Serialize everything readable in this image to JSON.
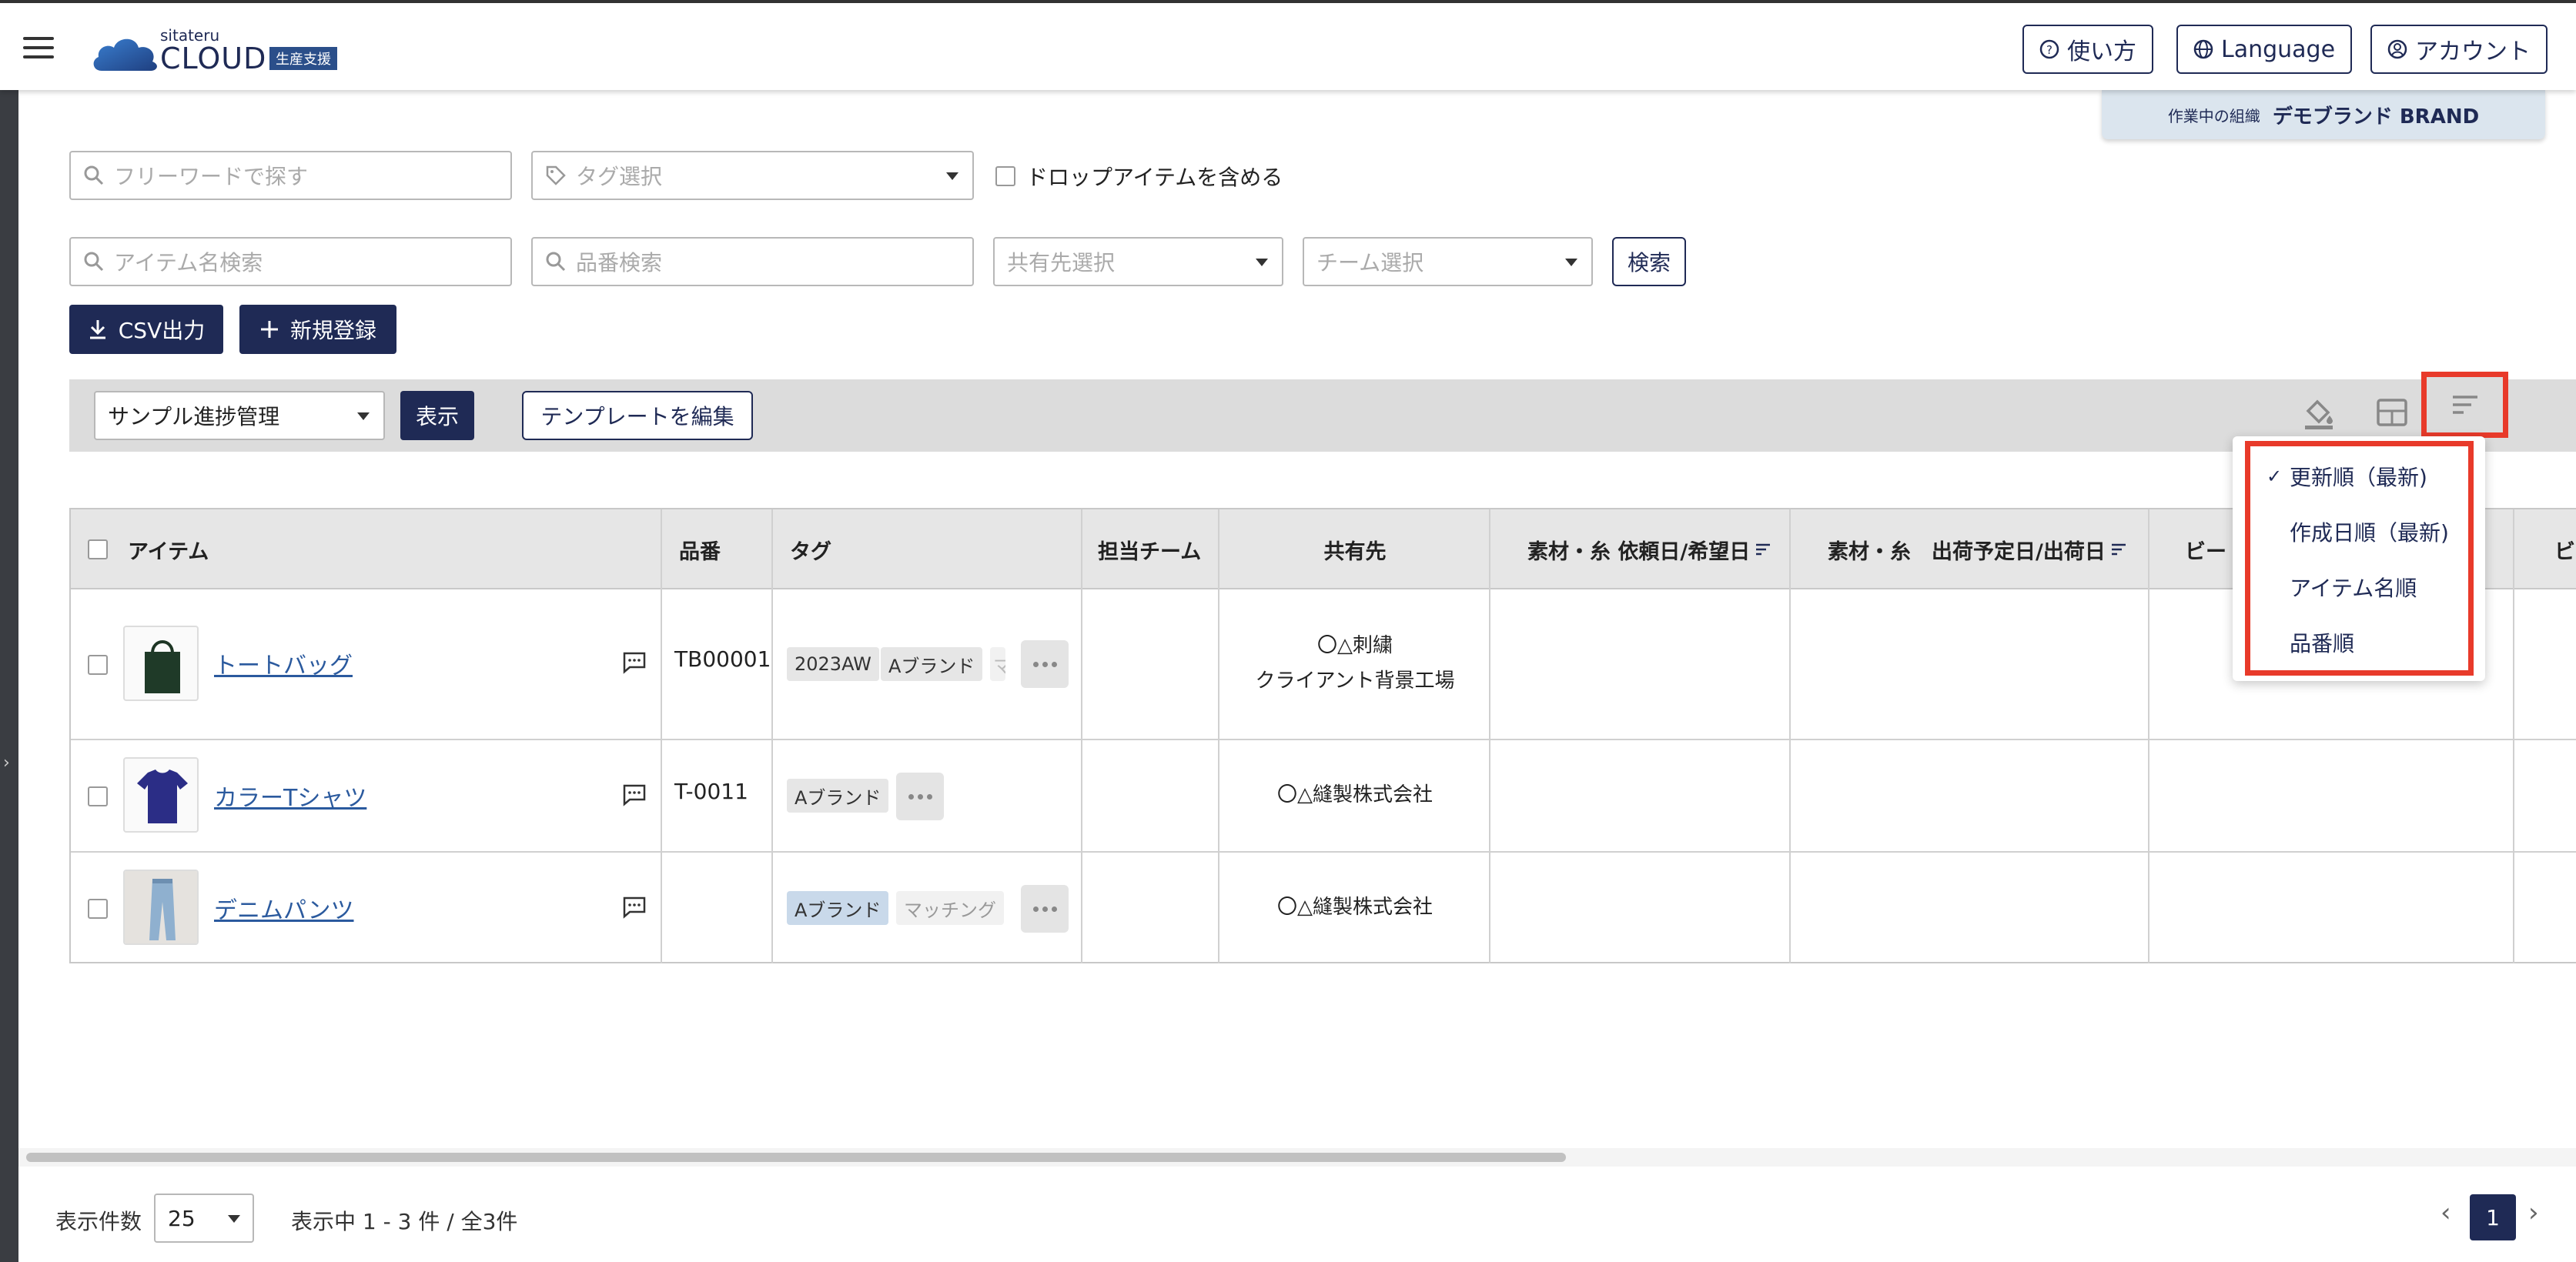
{
  "header": {
    "logo_small": "sitateru",
    "logo_main": "CLOUD",
    "logo_badge": "生産支援",
    "help_label": "使い方",
    "language_label": "Language",
    "account_label": "アカウント",
    "org_label": "作業中の組織",
    "org_name": "デモブランド BRAND"
  },
  "filters": {
    "freeword_placeholder": "フリーワードで探す",
    "tag_placeholder": "タグ選択",
    "include_drop_label": "ドロップアイテムを含める",
    "item_name_placeholder": "アイテム名検索",
    "part_number_placeholder": "品番検索",
    "share_placeholder": "共有先選択",
    "team_placeholder": "チーム選択",
    "search_label": "検索"
  },
  "actions": {
    "csv_label": "CSV出力",
    "new_label": "新規登録"
  },
  "toolbar": {
    "view_select": "サンプル進捗管理",
    "show_label": "表示",
    "edit_template_label": "テンプレートを編集"
  },
  "sort_menu": {
    "items": [
      {
        "label": "更新順（最新)",
        "selected": true
      },
      {
        "label": "作成日順（最新)",
        "selected": false
      },
      {
        "label": "アイテム名順",
        "selected": false
      },
      {
        "label": "品番順",
        "selected": false
      }
    ],
    "check": "✓"
  },
  "table": {
    "headers": {
      "item": "アイテム",
      "part_number": "品番",
      "tag": "タグ",
      "team": "担当チーム",
      "share": "共有先",
      "material_request": "素材・糸 依頼日/希望日",
      "material_ship": "素材・糸　出荷予定日/出荷日",
      "beads": "ビー",
      "beads2": "ビ"
    },
    "rows": [
      {
        "name": "トートバッグ",
        "part_number": "TB00001",
        "tags": [
          "2023AW",
          "Aブランド",
          "マ"
        ],
        "share_lines": [
          "〇△刺繍",
          "クライアント背景工場"
        ]
      },
      {
        "name": "カラーTシャツ",
        "part_number": "T-0011",
        "tags": [
          "Aブランド"
        ],
        "share_lines": [
          "〇△縫製株式会社"
        ]
      },
      {
        "name": "デニムパンツ",
        "part_number": "",
        "tags": [
          "Aブランド",
          "マッチング"
        ],
        "share_lines": [
          "〇△縫製株式会社"
        ]
      }
    ]
  },
  "footer": {
    "per_page_label": "表示件数",
    "per_page_value": "25",
    "range_text": "表示中 1 - 3 件 / 全3件",
    "page": "1",
    "prev": "‹",
    "next": "›"
  },
  "colors": {
    "navy": "#1f2a55",
    "highlight_red": "#e83a2a",
    "link_blue": "#2b5a9e"
  }
}
